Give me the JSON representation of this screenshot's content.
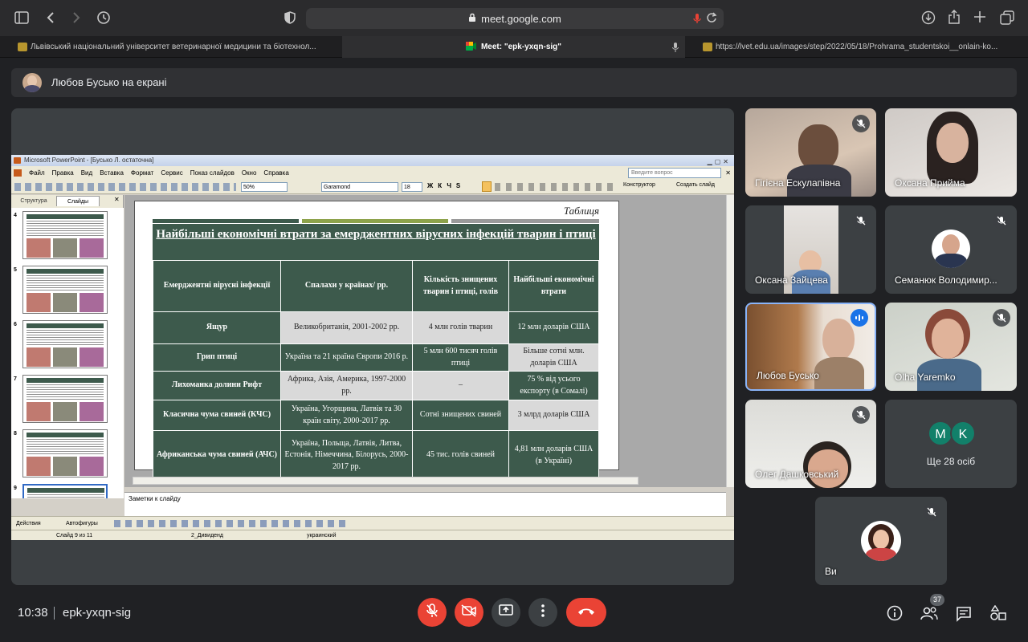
{
  "browser": {
    "url": "meet.google.com",
    "tabs": [
      {
        "label": "Львівський національний університет ветеринарної медицини та біотехнол..."
      },
      {
        "label": "Meet: \"epk-yxqn-sig\""
      },
      {
        "label": "https://lvet.edu.ua/images/step/2022/05/18/Prohrama_studentskoi__onlain-ko..."
      }
    ]
  },
  "presenter_bar": {
    "text": "Любов Бусько на екрані"
  },
  "ppt": {
    "window_title": "Microsoft PowerPoint - [Бусько Л. остаточна]",
    "menu": [
      "Файл",
      "Правка",
      "Вид",
      "Вставка",
      "Формат",
      "Сервис",
      "Показ слайдов",
      "Окно",
      "Справка"
    ],
    "help_placeholder": "Введите вопрос",
    "zoom": "50%",
    "font": "Garamond",
    "font_size": "18",
    "designer": "Конструктор",
    "new_slide": "Создать слайд",
    "panel_tabs": [
      "Структура",
      "Слайды"
    ],
    "thumb_numbers": [
      "4",
      "5",
      "6",
      "7",
      "8",
      "9"
    ],
    "notes": "Заметки к слайду",
    "drawing": {
      "actions": "Действия",
      "autoshapes": "Автофигуры"
    },
    "status": {
      "slide": "Слайд 9 из 11",
      "design": "2_Дивиденд",
      "lang": "украинский"
    }
  },
  "slide": {
    "label": "Таблиця",
    "title": "Найбільші економічні втрати  за емерджентних вірусних інфекцій тварин і птиці",
    "headers": [
      "Емерджентні вірусні інфекції",
      "Спалахи у країнах/ рр.",
      "Кількість знищених тварин і птиці, голів",
      "Найбільші економічні втрати"
    ],
    "rows": [
      [
        "Ящур",
        "Великобританія, 2001-2002 рр.",
        "4 млн голів тварин",
        "12 млн доларів США"
      ],
      [
        "Грип птиці",
        "Україна та 21 країна Європи 2016 р.",
        "5 млн 600 тисяч голів птиці",
        "Більше сотні млн. доларів США"
      ],
      [
        "Лихоманка долини Рифт",
        "Африка, Азія, Америка, 1997-2000 рр.",
        "–",
        "75 % від усього експорту (в Сомалі)"
      ],
      [
        "Класична чума свиней (КЧС)",
        "Україна, Угорщина, Латвія та 30 країн світу, 2000-2017 рр.",
        "Сотні знищених свиней",
        "3 млрд доларів США"
      ],
      [
        "Африканська чума свиней (АЧС)",
        "Україна, Польща, Латвія, Литва, Естонія, Німеччина, Білорусь, 2000-2017 рр.",
        "45 тис. голів свиней",
        "4,81 млн доларів США (в Україні)"
      ]
    ]
  },
  "participants": [
    {
      "name": "Гігієна Ескулапівна"
    },
    {
      "name": "Оксана Прийма"
    },
    {
      "name": "Оксана Зайцева"
    },
    {
      "name": "Семанюк Володимир..."
    },
    {
      "name": "Любов Бусько"
    },
    {
      "name": "Olha Yaremko"
    },
    {
      "name": "Олег Дашковський"
    },
    {
      "name": "Ще 28 осіб",
      "initials": [
        "M",
        "K"
      ]
    },
    {
      "name": "Ви"
    }
  ],
  "bottom": {
    "time": "10:38",
    "meeting_code": "epk-yxqn-sig",
    "people_count": "37"
  },
  "colors": {
    "end_call": "#ea4335",
    "accent": "#8ab4f8",
    "slide_green": "#3d5a4c"
  }
}
